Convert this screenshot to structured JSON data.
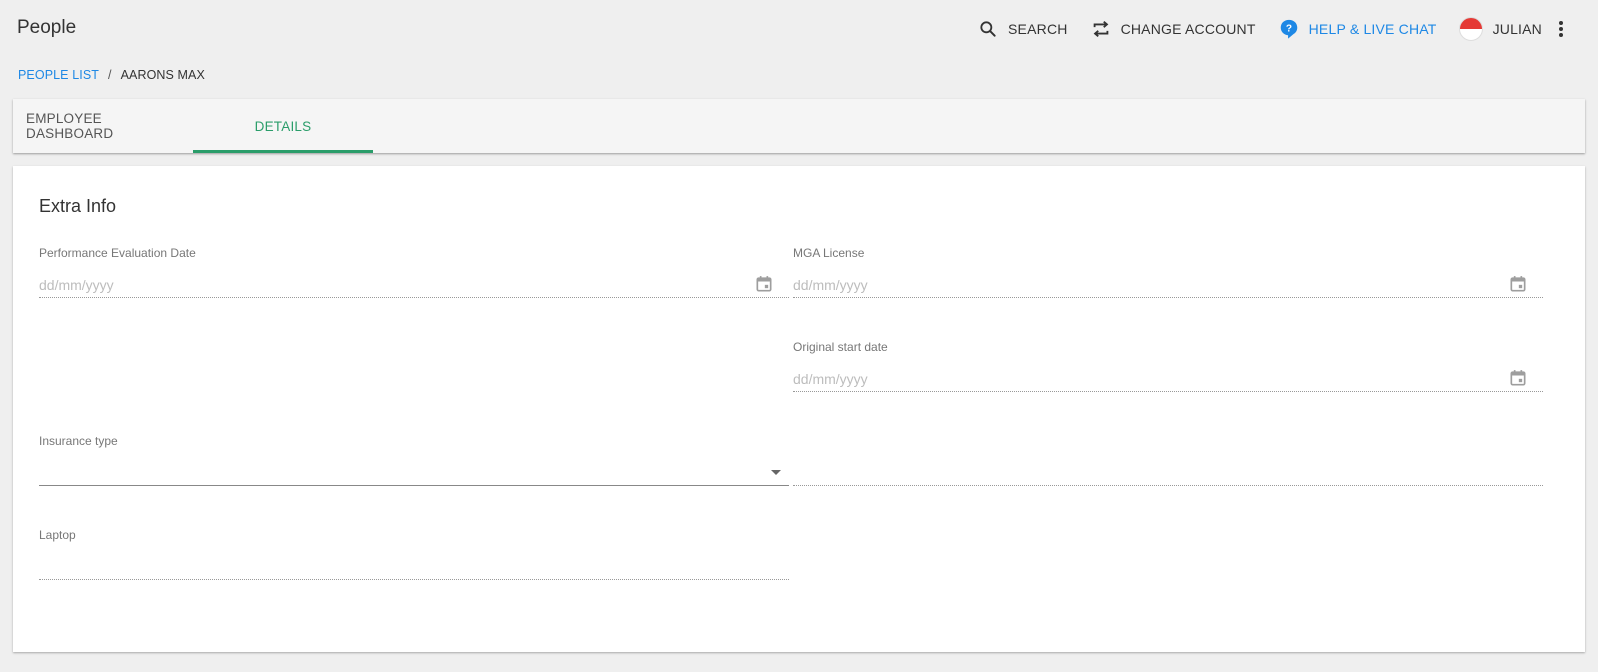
{
  "app": {
    "title": "People"
  },
  "header": {
    "search_label": "SEARCH",
    "change_account_label": "CHANGE ACCOUNT",
    "help_label": "HELP & LIVE CHAT",
    "user_name": "JULIAN",
    "help_color": "#1e88e5"
  },
  "breadcrumb": {
    "link": "PEOPLE LIST",
    "separator": "/",
    "current": "AARONS MAX"
  },
  "tabs": [
    {
      "label": "EMPLOYEE DASHBOARD",
      "active": false
    },
    {
      "label": "DETAILS",
      "active": true
    }
  ],
  "accent_color": "#2a9d6a",
  "card": {
    "title": "Extra Info",
    "fields": {
      "performance_evaluation": {
        "label": "Performance Evaluation Date",
        "placeholder": "dd/mm/yyyy",
        "icon": "calendar-icon"
      },
      "mga_license": {
        "label": "MGA License",
        "placeholder": "dd/mm/yyyy",
        "icon": "calendar-icon"
      },
      "original_start": {
        "label": "Original start date",
        "placeholder": "dd/mm/yyyy",
        "icon": "calendar-icon"
      },
      "insurance_type": {
        "label": "Insurance type",
        "value": "",
        "icon": "chevron-down-icon"
      },
      "unlabeled_field": {
        "label": "",
        "value": ""
      },
      "laptop": {
        "label": "Laptop",
        "value": ""
      }
    }
  }
}
